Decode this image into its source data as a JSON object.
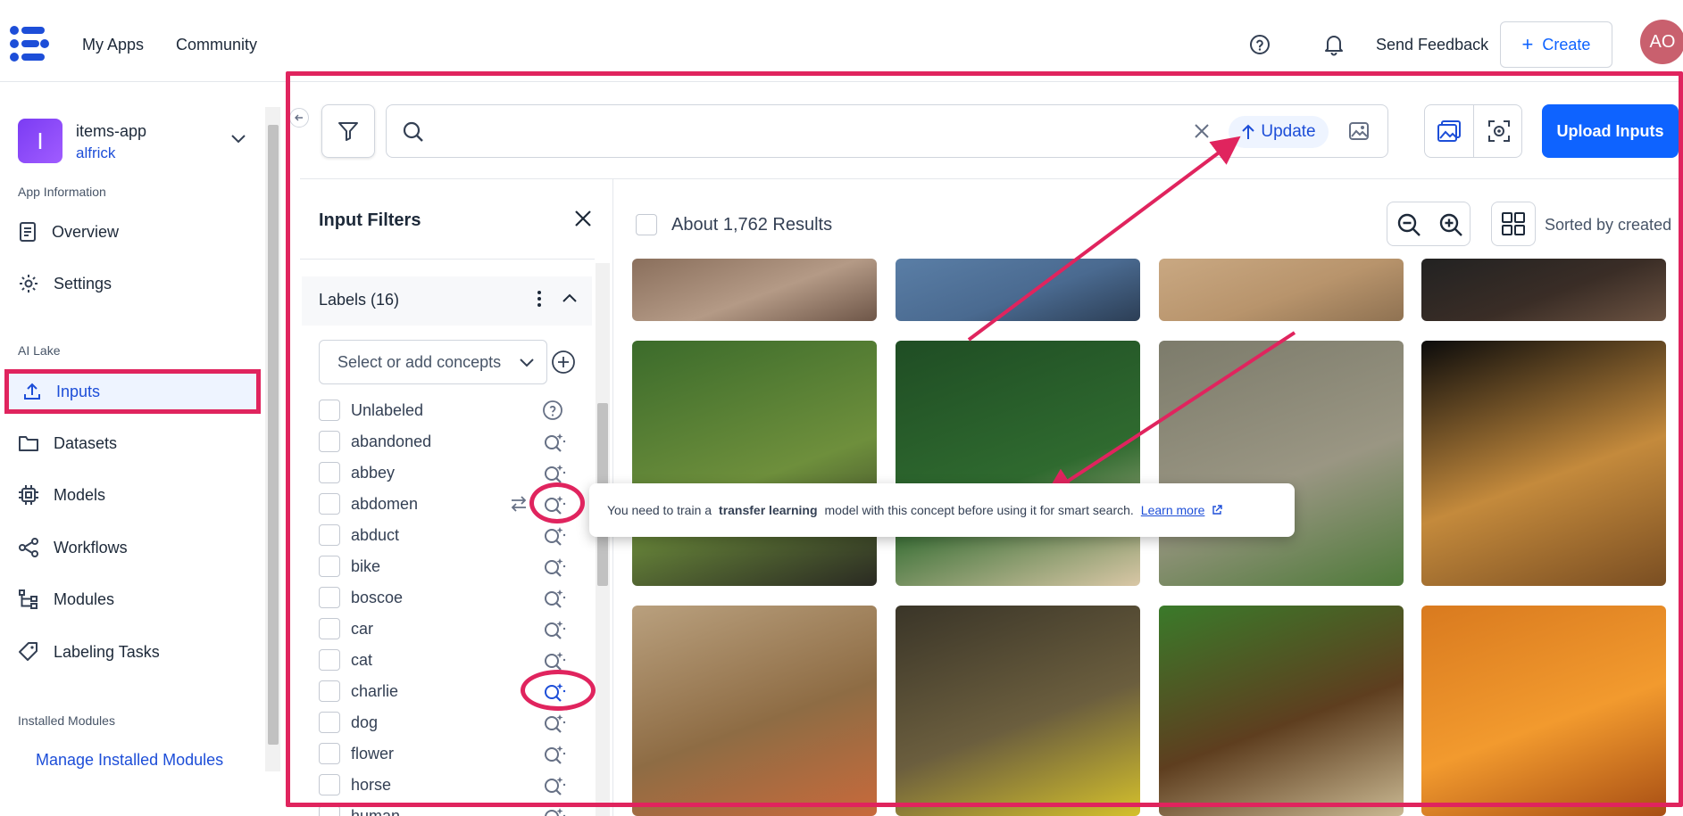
{
  "topbar": {
    "nav_my_apps": "My Apps",
    "nav_community": "Community",
    "send_feedback": "Send Feedback",
    "create": "Create",
    "avatar_initials": "AO"
  },
  "sidebar": {
    "app_initial": "I",
    "app_name": "items-app",
    "app_user": "alfrick",
    "section_app_info": "App Information",
    "overview": "Overview",
    "settings": "Settings",
    "section_ai_lake": "AI Lake",
    "inputs": "Inputs",
    "datasets": "Datasets",
    "models": "Models",
    "workflows": "Workflows",
    "modules": "Modules",
    "labeling_tasks": "Labeling Tasks",
    "section_installed": "Installed Modules",
    "manage_installed": "Manage Installed Modules"
  },
  "search": {
    "update_label": "Update",
    "upload_label": "Upload Inputs"
  },
  "filters": {
    "title": "Input Filters",
    "labels_title": "Labels (16)",
    "concept_placeholder": "Select or add concepts",
    "items": [
      "Unlabeled",
      "abandoned",
      "abbey",
      "abdomen",
      "abduct",
      "bike",
      "boscoe",
      "car",
      "cat",
      "charlie",
      "dog",
      "flower",
      "horse",
      "human"
    ]
  },
  "results": {
    "count_label": "About 1,762 Results",
    "sorted_label": "Sorted by created"
  },
  "tooltip": {
    "prefix": "You need to train a",
    "bold": "transfer learning",
    "suffix": "model with this concept before using it for smart search.",
    "link": "Learn more"
  },
  "gallery": {
    "tiles": [
      "pavement-dog",
      "sky-bird",
      "dirt-road",
      "dark-animal",
      "puppy-grass",
      "labrador",
      "elephants",
      "ram",
      "antelope",
      "cat-face",
      "puppies",
      "monks"
    ]
  },
  "colors": {
    "accent": "#0e63ff",
    "highlight": "#e0245e",
    "active_bg": "#eef4ff"
  }
}
